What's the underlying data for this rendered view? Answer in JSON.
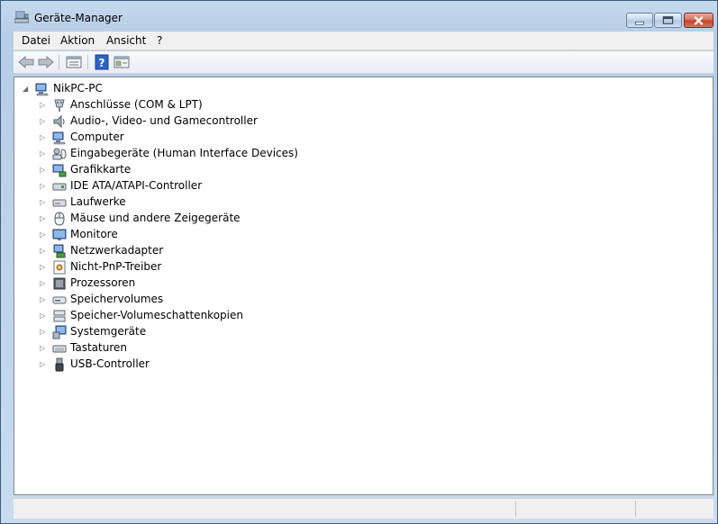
{
  "window": {
    "title": "Geräte-Manager",
    "minimize_icon": "minimize-icon",
    "maximize_icon": "maximize-icon",
    "close_icon": "close-icon"
  },
  "menu": [
    {
      "label": "Datei"
    },
    {
      "label": "Aktion"
    },
    {
      "label": "Ansicht"
    },
    {
      "label": "?"
    }
  ],
  "toolbar": {
    "buttons": [
      "back-arrow-icon",
      "forward-arrow-icon",
      "properties-icon",
      "help-icon",
      "console-tree-icon"
    ]
  },
  "tree": {
    "root": {
      "label": "NikPC-PC",
      "icon": "computer-icon",
      "expanded": true
    },
    "items": [
      {
        "label": "Anschlüsse (COM & LPT)",
        "icon": "port-icon"
      },
      {
        "label": "Audio-, Video- und Gamecontroller",
        "icon": "speaker-icon"
      },
      {
        "label": "Computer",
        "icon": "computer-icon"
      },
      {
        "label": "Eingabegeräte (Human Interface Devices)",
        "icon": "hid-icon"
      },
      {
        "label": "Grafikkarte",
        "icon": "display-adapter-icon"
      },
      {
        "label": "IDE ATA/ATAPI-Controller",
        "icon": "ide-controller-icon"
      },
      {
        "label": "Laufwerke",
        "icon": "disk-drive-icon"
      },
      {
        "label": "Mäuse und andere Zeigegeräte",
        "icon": "mouse-icon"
      },
      {
        "label": "Monitore",
        "icon": "monitor-icon"
      },
      {
        "label": "Netzwerkadapter",
        "icon": "network-adapter-icon"
      },
      {
        "label": "Nicht-PnP-Treiber",
        "icon": "driver-icon"
      },
      {
        "label": "Prozessoren",
        "icon": "processor-icon"
      },
      {
        "label": "Speichervolumes",
        "icon": "storage-volume-icon"
      },
      {
        "label": "Speicher-Volumeschattenkopien",
        "icon": "shadow-copy-icon"
      },
      {
        "label": "Systemgeräte",
        "icon": "system-device-icon"
      },
      {
        "label": "Tastaturen",
        "icon": "keyboard-icon"
      },
      {
        "label": "USB-Controller",
        "icon": "usb-icon"
      }
    ]
  },
  "statusbar": {
    "cells": [
      "",
      "",
      ""
    ]
  }
}
